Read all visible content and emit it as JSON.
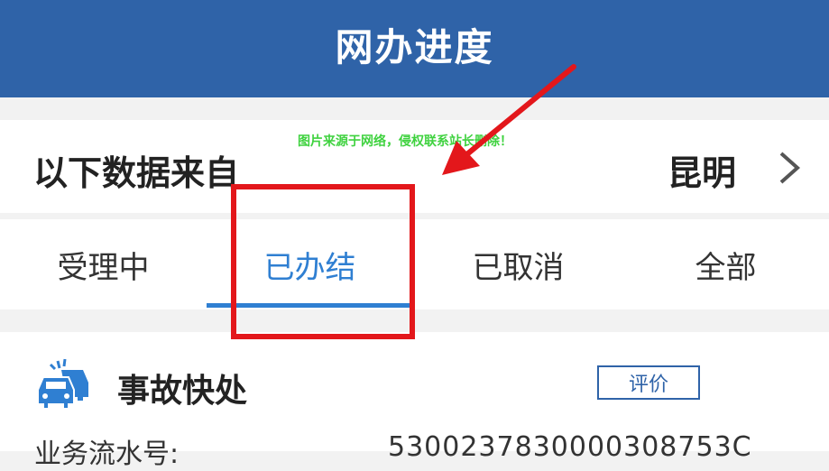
{
  "header": {
    "title": "网办进度"
  },
  "source": {
    "label": "以下数据来自",
    "city": "昆明"
  },
  "watermark": "图片来源于网络，侵权联系站长删除！",
  "tabs": [
    {
      "label": "受理中",
      "active": false
    },
    {
      "label": "已办结",
      "active": true
    },
    {
      "label": "已取消",
      "active": false
    },
    {
      "label": "全部",
      "active": false
    }
  ],
  "card": {
    "name": "事故快处",
    "rate_label": "评价",
    "serial_label": "业务流水号:",
    "serial_value": "5300237830000308753C"
  },
  "colors": {
    "header": "#2f63a8",
    "accent": "#2f7fd2",
    "annotation": "#e3171b",
    "watermark": "#3fd23f"
  }
}
